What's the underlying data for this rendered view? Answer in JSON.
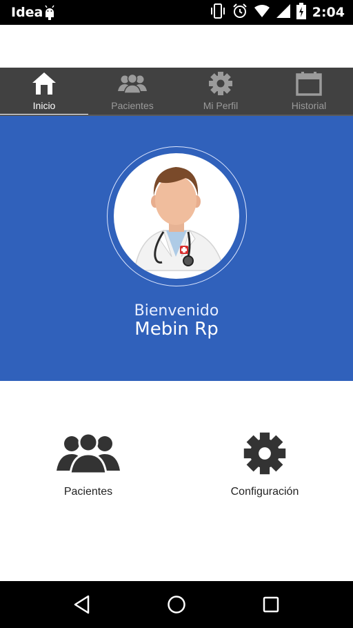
{
  "status_bar": {
    "carrier": "Idea",
    "time": "2:04"
  },
  "tabs": [
    {
      "label": "Inicio",
      "icon": "home-icon",
      "active": true
    },
    {
      "label": "Pacientes",
      "icon": "users-icon",
      "active": false
    },
    {
      "label": "Mi Perfil",
      "icon": "gear-icon",
      "active": false
    },
    {
      "label": "Historial",
      "icon": "calendar-icon",
      "active": false
    }
  ],
  "hero": {
    "greeting": "Bienvenido",
    "user_name": "Mebin Rp",
    "background": "#3061bb",
    "avatar_icon": "doctor-avatar"
  },
  "menu": [
    {
      "label": "Pacientes",
      "icon": "users-icon"
    },
    {
      "label": "Configuración",
      "icon": "gear-icon"
    }
  ],
  "navigation": {
    "back": "back-icon",
    "home": "home-circle-icon",
    "recents": "recents-icon"
  }
}
